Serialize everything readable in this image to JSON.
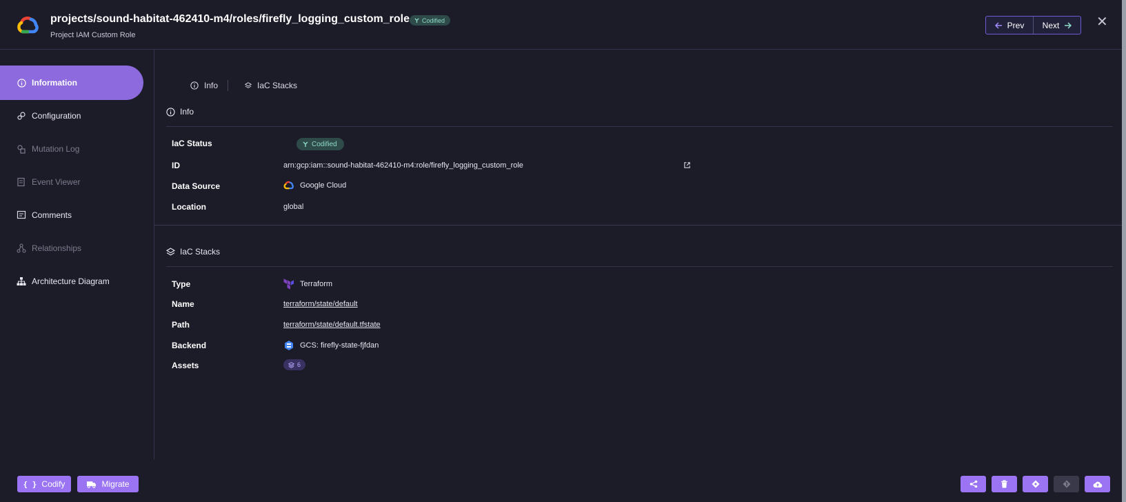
{
  "header": {
    "title": "projects/sound-habitat-462410-m4/roles/firefly_logging_custom_role",
    "subtitle": "Project IAM Custom Role",
    "badge": "Codified",
    "prev_label": "Prev",
    "next_label": "Next",
    "close_label": "✕"
  },
  "sidebar": {
    "items": [
      {
        "label": "Information",
        "icon": "info-icon",
        "state": "active"
      },
      {
        "label": "Configuration",
        "icon": "gears-icon",
        "state": "enabled"
      },
      {
        "label": "Mutation Log",
        "icon": "history-icon",
        "state": "disabled"
      },
      {
        "label": "Event Viewer",
        "icon": "event-icon",
        "state": "disabled"
      },
      {
        "label": "Comments",
        "icon": "comments-icon",
        "state": "enabled"
      },
      {
        "label": "Relationships",
        "icon": "relationships-icon",
        "state": "disabled"
      },
      {
        "label": "Architecture Diagram",
        "icon": "sitemap-icon",
        "state": "enabled"
      }
    ]
  },
  "tabs": [
    {
      "label": "Info",
      "icon": "info-icon"
    },
    {
      "label": "IaC Stacks",
      "icon": "layers-icon"
    }
  ],
  "info": {
    "title": "Info",
    "rows": {
      "iac_status_label": "IaC Status",
      "iac_status_value": "Codified",
      "id_label": "ID",
      "id_value": "arn:gcp:iam::sound-habitat-462410-m4:role/firefly_logging_custom_role",
      "data_source_label": "Data Source",
      "data_source_value": "Google Cloud",
      "location_label": "Location",
      "location_value": "global"
    }
  },
  "iac_stacks": {
    "title": "IaC Stacks",
    "rows": {
      "type_label": "Type",
      "type_value": "Terraform",
      "name_label": "Name",
      "name_value": "terraform/state/default",
      "path_label": "Path",
      "path_value": "terraform/state/default.tfstate",
      "backend_label": "Backend",
      "backend_value": "GCS: firefly-state-fjfdan",
      "assets_label": "Assets",
      "assets_value": "6"
    }
  },
  "footer": {
    "codify_label": "Codify",
    "migrate_label": "Migrate",
    "icon_buttons": [
      "share-icon",
      "trash-icon",
      "diamond-icon",
      "git-icon",
      "cloud-upload-icon"
    ]
  },
  "colors": {
    "background": "#1c1b28",
    "accent": "#9a74f2",
    "active_sidebar": "#8d6bde",
    "codified_bg": "#2e4a49",
    "codified_text": "#8fdcc8"
  }
}
